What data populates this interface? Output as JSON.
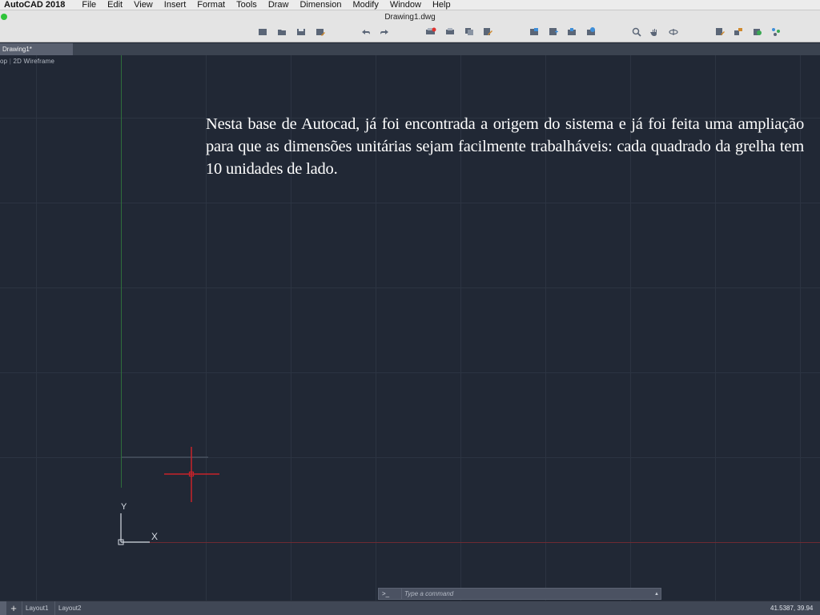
{
  "menubar": {
    "app_name": "AutoCAD 2018",
    "items": [
      "File",
      "Edit",
      "View",
      "Insert",
      "Format",
      "Tools",
      "Draw",
      "Dimension",
      "Modify",
      "Window",
      "Help"
    ]
  },
  "window": {
    "title": "Drawing1.dwg"
  },
  "toolbar": {
    "icons": [
      "new-icon",
      "open-icon",
      "save-icon",
      "save-as-icon",
      "undo-icon",
      "redo-icon",
      "plot-icon",
      "print-icon",
      "copy-icon",
      "paste-icon",
      "layer-icon",
      "block-icon",
      "insert-icon",
      "table-icon",
      "zoom-icon",
      "pan-icon",
      "orbit-icon",
      "properties-icon",
      "match-icon",
      "render-icon",
      "connect-icon"
    ]
  },
  "tabs": {
    "active": "Drawing1*"
  },
  "viewport": {
    "label_view": "op",
    "label_style": "2D Wireframe",
    "ucs_y": "Y",
    "ucs_x": "X",
    "annotation": "Nesta base de Autocad, já foi encontrada a origem do sistema e já foi feita uma ampliação para que as dimensões unitárias sejam facilmente trabalháveis: cada quadrado da grelha tem 10 unidades de lado.",
    "colors": {
      "background": "#212835",
      "grid": "#2c3442",
      "y_axis": "#2e6e3c",
      "x_axis": "#6e2b33",
      "crosshair": "#c8222a"
    }
  },
  "command": {
    "prompt": ">_",
    "placeholder": "Type a command"
  },
  "statusbar": {
    "layouts": [
      "Layout1",
      "Layout2"
    ],
    "coordinates": "41.5387, 39.94"
  }
}
